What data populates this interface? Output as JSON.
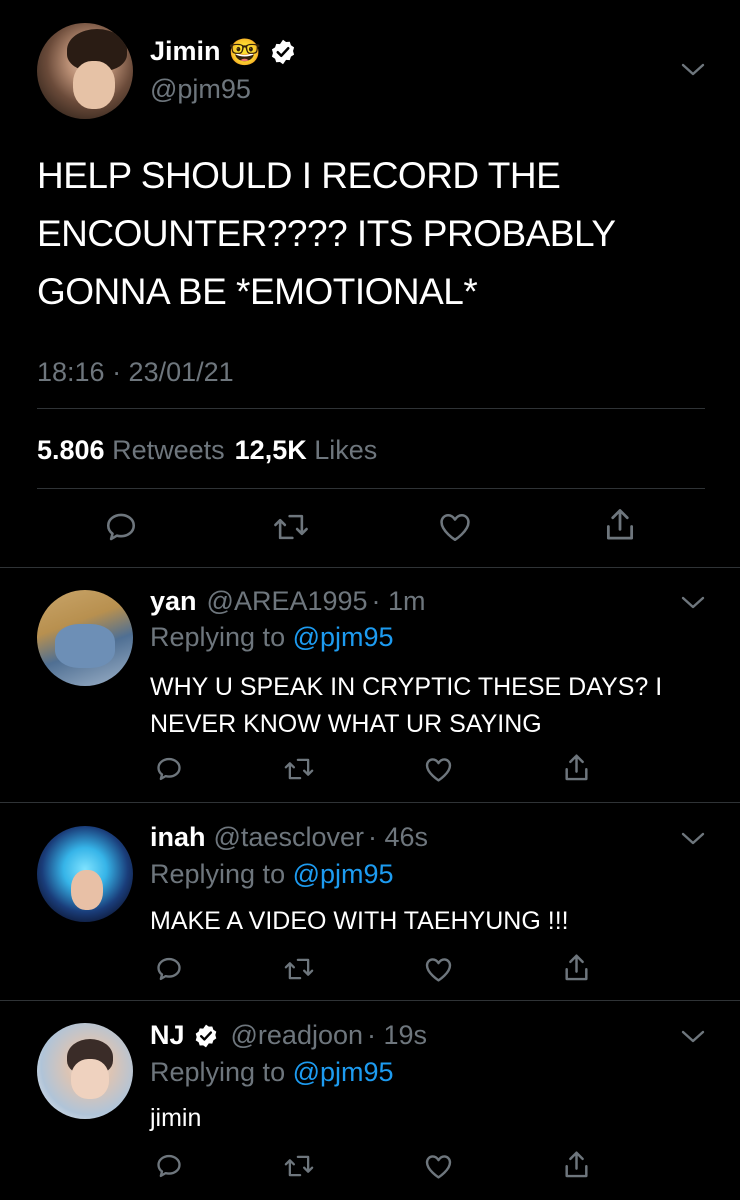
{
  "main_tweet": {
    "name": "Jimin",
    "emoji": "🤓",
    "handle": "@pjm95",
    "text": "HELP SHOULD I RECORD THE ENCOUNTER???? ITS PROBABLY GONNA BE *EMOTIONAL*",
    "time": "18:16 · 23/01/21",
    "retweets_count": "5.806",
    "retweets_label": "Retweets",
    "likes_count": "12,5K",
    "likes_label": "Likes"
  },
  "replies": [
    {
      "name": "yan",
      "handle": "@AREA1995",
      "time": "· 1m",
      "replying_prefix": "Replying to",
      "replying_to": "@pjm95",
      "text": "WHY U SPEAK IN CRYPTIC THESE DAYS? I NEVER KNOW WHAT UR SAYING"
    },
    {
      "name": "inah",
      "handle": "@taesclover",
      "time": "· 46s",
      "replying_prefix": "Replying to",
      "replying_to": "@pjm95",
      "text": "MAKE A VIDEO WITH TAEHYUNG !!!"
    },
    {
      "name": "NJ",
      "handle": "@readjoon",
      "time": "· 19s",
      "replying_prefix": "Replying to",
      "replying_to": "@pjm95",
      "text": "jimin"
    }
  ],
  "colors": {
    "background": "#000000",
    "muted": "#6e767d",
    "link": "#1d9bf0",
    "divider": "#2f3336"
  },
  "icons": [
    "chevron-down-icon",
    "verified-badge-icon",
    "reply-icon",
    "retweet-icon",
    "like-icon",
    "share-icon"
  ]
}
